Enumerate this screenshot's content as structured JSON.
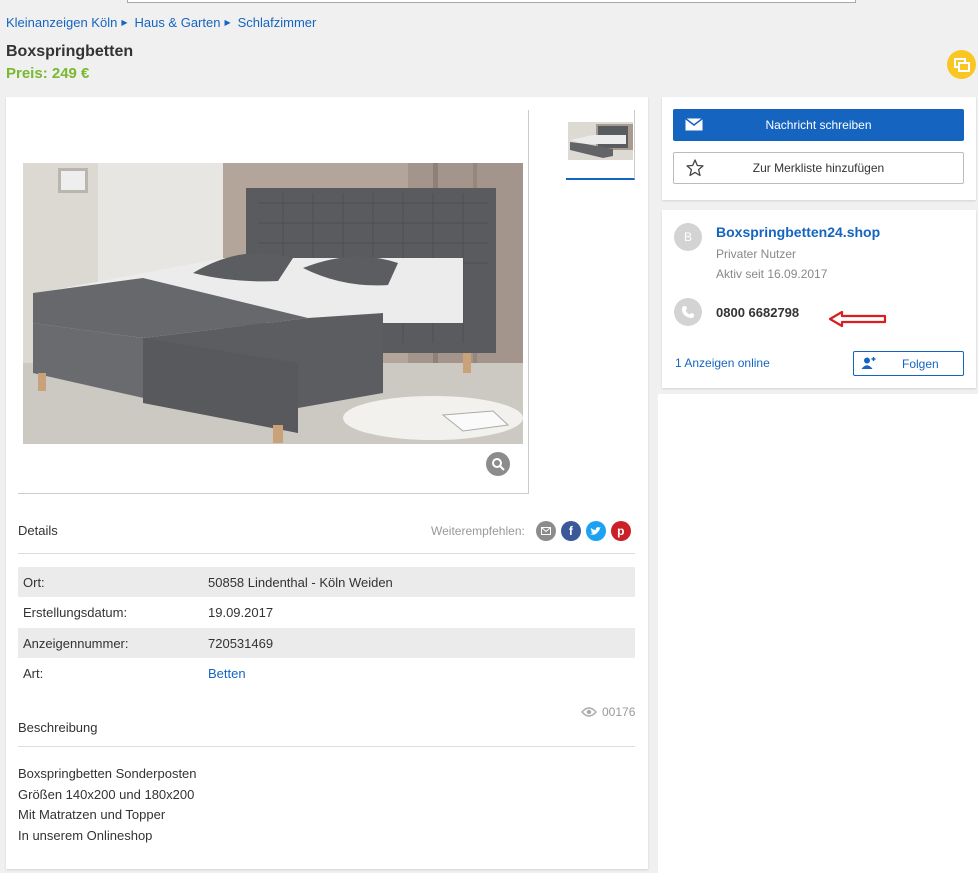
{
  "breadcrumb": [
    {
      "label": "Kleinanzeigen Köln"
    },
    {
      "label": "Haus & Garten"
    },
    {
      "label": "Schlafzimmer"
    }
  ],
  "listing": {
    "title": "Boxspringbetten",
    "price": "Preis: 249 €"
  },
  "details": {
    "heading": "Details",
    "share_label": "Weiterempfehlen:",
    "rows": [
      {
        "key": "Ort:",
        "value": "50858 Lindenthal - Köln Weiden"
      },
      {
        "key": "Erstellungsdatum:",
        "value": "19.09.2017"
      },
      {
        "key": "Anzeigennummer:",
        "value": "720531469"
      },
      {
        "key": "Art:",
        "value": "Betten"
      }
    ]
  },
  "views": "00176",
  "description": {
    "heading": "Beschreibung",
    "lines": [
      "Boxspringbetten Sonderposten",
      "Größen 140x200 und 180x200",
      "Mit Matratzen und Topper",
      "In unserem Onlineshop"
    ]
  },
  "contact": {
    "message_label": "Nachricht schreiben",
    "watchlist_label": "Zur Merkliste hinzufügen"
  },
  "seller": {
    "avatar_letter": "B",
    "name": "Boxspringbetten24.shop",
    "type": "Privater Nutzer",
    "active_since": "Aktiv seit 16.09.2017",
    "phone": "0800 6682798",
    "ads_online": "1 Anzeigen online",
    "follow_label": "Folgen"
  },
  "icons": {
    "share_email": "envelope-icon",
    "share_facebook": "facebook-icon",
    "share_twitter": "twitter-icon",
    "share_pinterest": "pinterest-icon"
  },
  "colors": {
    "link": "#1565c0",
    "price": "#7ab82e",
    "primary_button": "#1565c0",
    "badge": "#f9c623",
    "annotation_arrow": "#d81e1e"
  }
}
